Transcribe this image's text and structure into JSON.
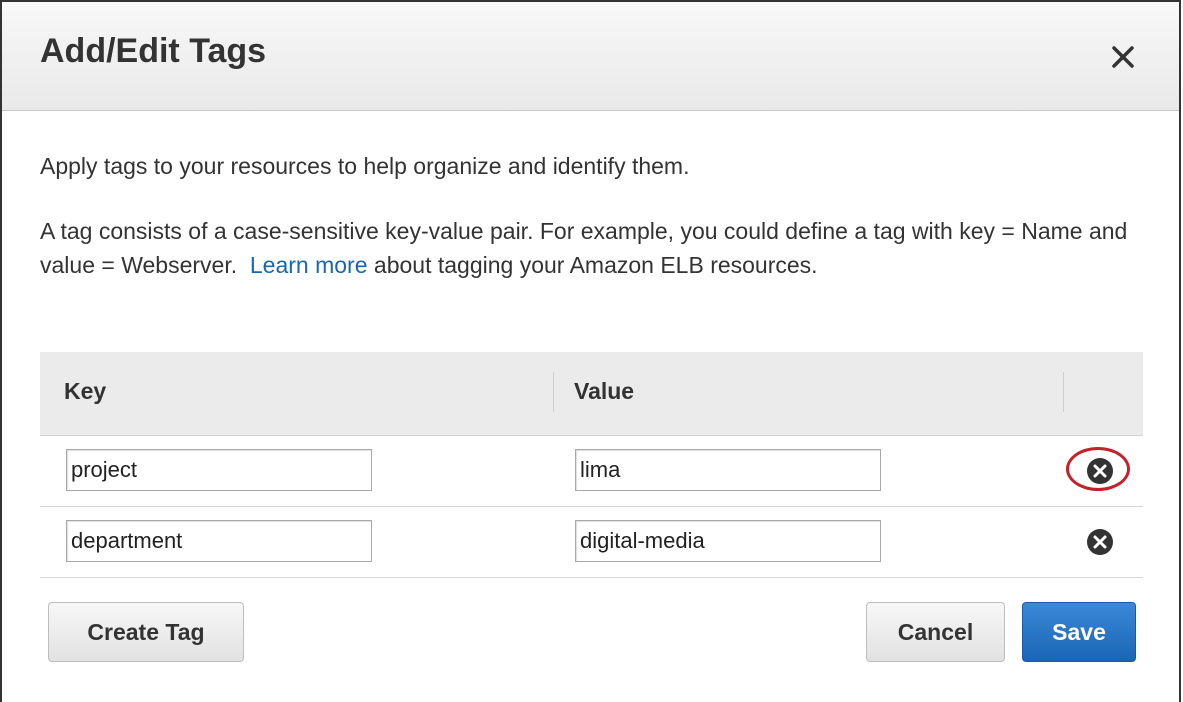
{
  "dialog": {
    "title": "Add/Edit Tags",
    "intro": "Apply tags to your resources to help organize and identify them.",
    "description_before_link": "A tag consists of a case-sensitive key-value pair. For example, you could define a tag with key = Name and value = Webserver.",
    "link_text": "Learn more",
    "description_after_link": "about tagging your Amazon ELB resources."
  },
  "table": {
    "columns": {
      "key": "Key",
      "value": "Value"
    },
    "rows": [
      {
        "key": "project",
        "value": "lima",
        "highlighted": true
      },
      {
        "key": "department",
        "value": "digital-media",
        "highlighted": false
      }
    ]
  },
  "buttons": {
    "create_tag": "Create Tag",
    "cancel": "Cancel",
    "save": "Save"
  },
  "icons": {
    "close": "close-icon",
    "remove": "remove-circle-icon"
  },
  "colors": {
    "link": "#1a66b3",
    "save_button": "#1c64b5",
    "highlight": "#c6202a"
  }
}
